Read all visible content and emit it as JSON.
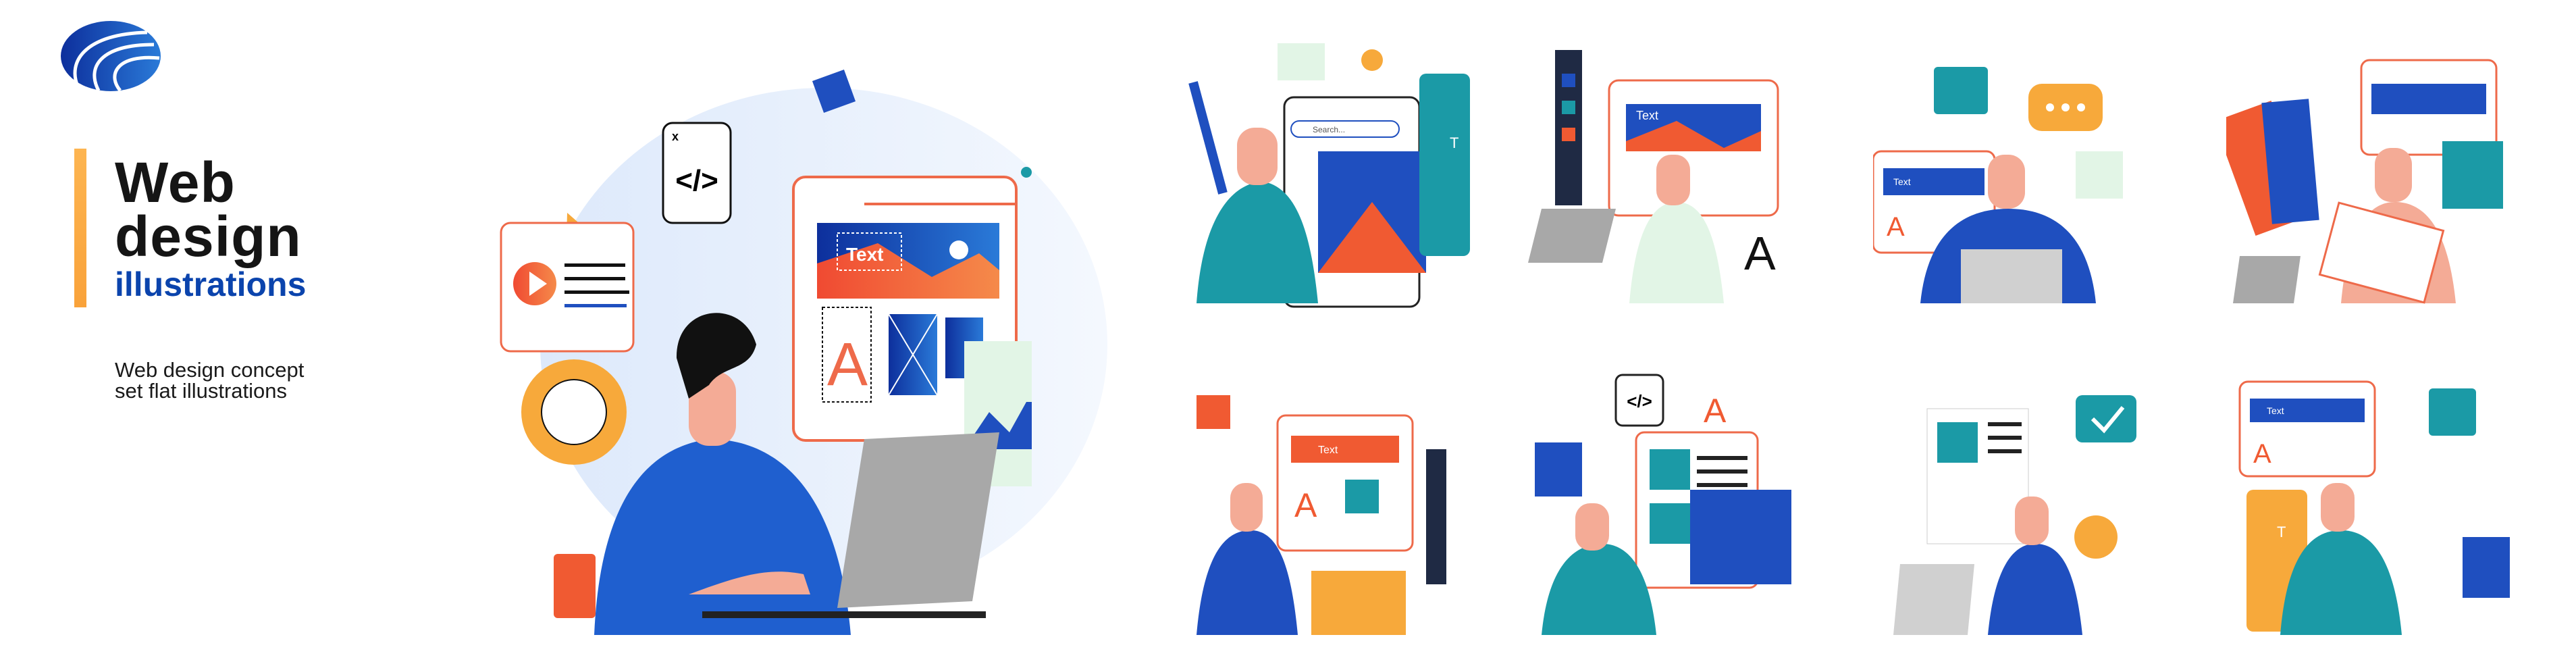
{
  "brand": {
    "logo": "blue-stripe-sphere-logo",
    "accent": "#0b44ad",
    "bar_color": "#f9a23a"
  },
  "heading": {
    "line1": "Web",
    "line2": "design",
    "line3": "illustrations"
  },
  "subtitle": "Web design concept set flat illustrations",
  "hero": {
    "code_label": "</>",
    "close_label": "x",
    "banner_text": "Text",
    "letter": "A"
  },
  "scenes": [
    {
      "search_placeholder": "Search...",
      "tool_text": "T"
    },
    {
      "banner_text": "Text",
      "letter": "A"
    },
    {
      "banner_text": "Text",
      "letter": "A"
    },
    {},
    {
      "banner_text": "Text",
      "letter": "A"
    },
    {
      "code_label": "</>",
      "letter": "A"
    },
    {},
    {
      "banner_text": "Text",
      "letter": "A",
      "tool_text": "T"
    }
  ],
  "colors": {
    "blue": "#1f5fcf",
    "dark_blue": "#0b2f99",
    "orange": "#f0603a",
    "yellow": "#f7a93b",
    "teal": "#1b9aa6",
    "skin": "#f4ab96"
  }
}
